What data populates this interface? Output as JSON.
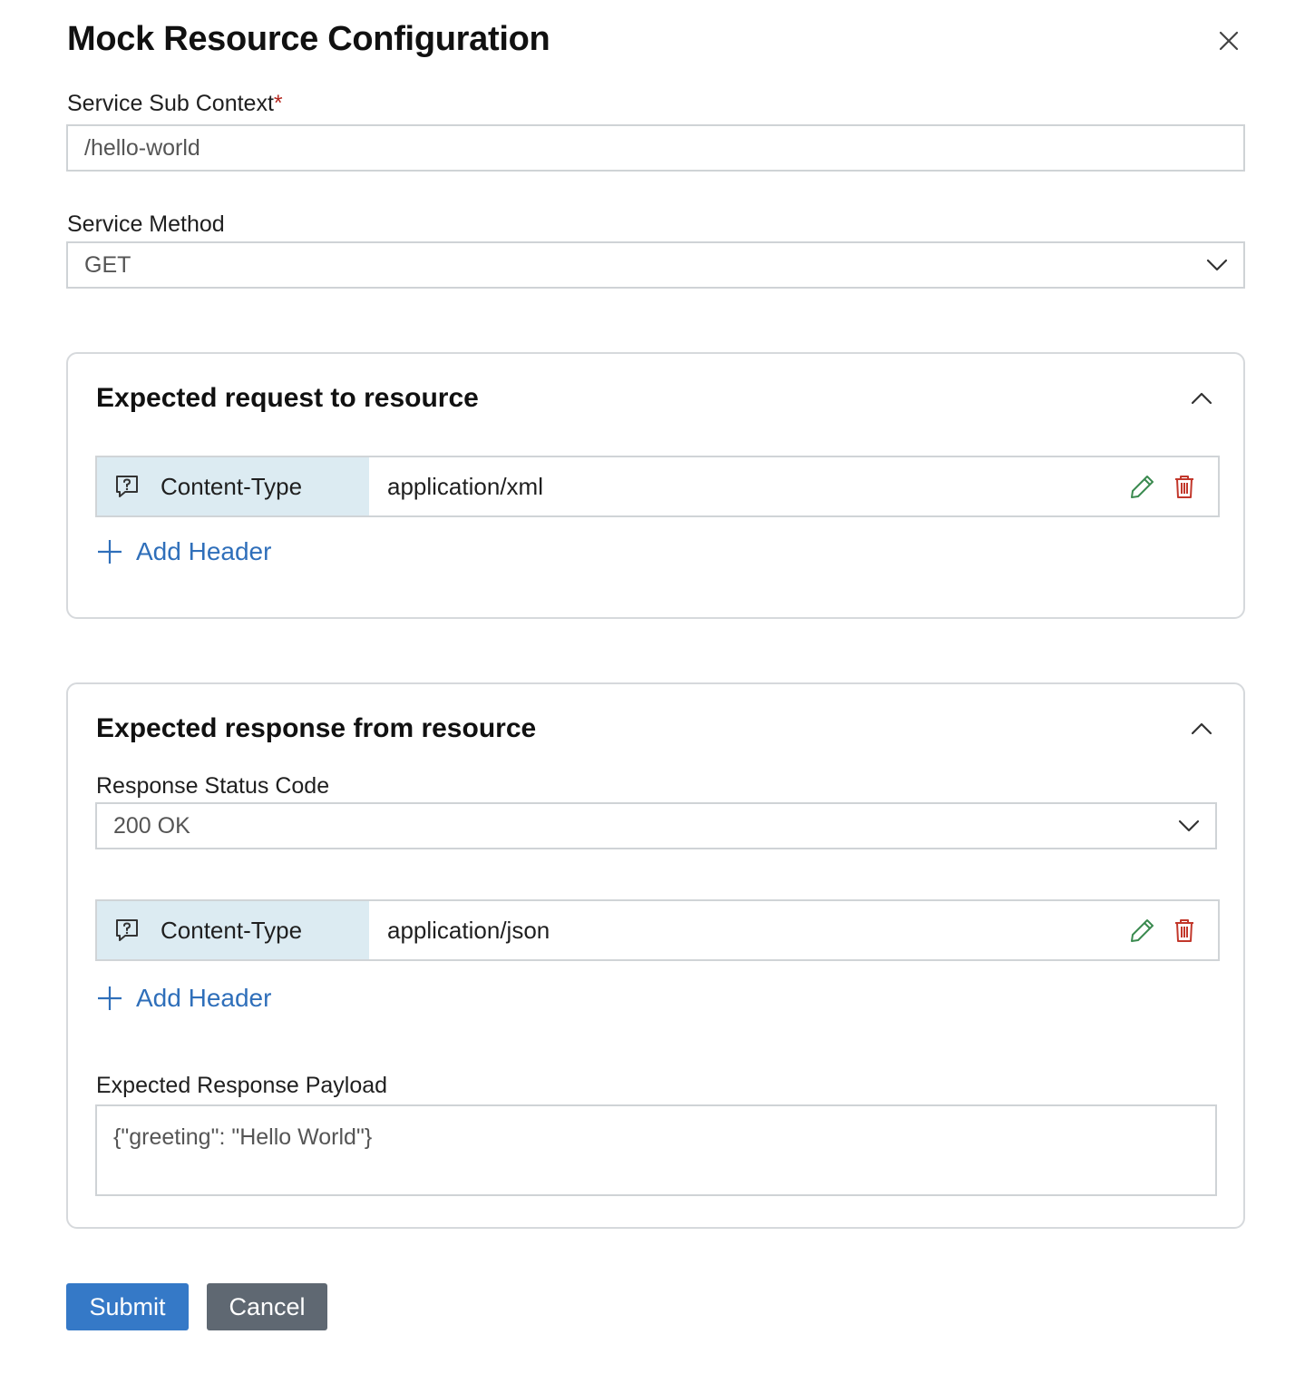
{
  "dialog": {
    "title": "Mock Resource Configuration"
  },
  "sub_context": {
    "label": "Service Sub Context",
    "required_mark": "*",
    "value": "/hello-world"
  },
  "method": {
    "label": "Service Method",
    "selected": "GET"
  },
  "request_panel": {
    "title": "Expected request to resource",
    "headers": [
      {
        "name": "Content-Type",
        "value": "application/xml"
      }
    ],
    "add_header_label": "Add Header"
  },
  "response_panel": {
    "title": "Expected response from resource",
    "status_label": "Response Status Code",
    "status_selected": "200 OK",
    "headers": [
      {
        "name": "Content-Type",
        "value": "application/json"
      }
    ],
    "add_header_label": "Add Header",
    "payload_label": "Expected Response Payload",
    "payload_value": "{\"greeting\": \"Hello World\"}"
  },
  "actions": {
    "submit_label": "Submit",
    "cancel_label": "Cancel"
  },
  "icons": {
    "close": "close-icon",
    "chevron": "chevron-down-icon",
    "collapse": "chevron-up-icon",
    "header": "comment-help-icon",
    "edit": "pencil-icon",
    "delete": "trash-icon",
    "add": "plus-icon"
  },
  "colors": {
    "primary": "#3579c7",
    "secondary": "#5f6872",
    "link": "#2f6fba",
    "edit": "#3a8a4f",
    "delete": "#c2372b",
    "key_bg": "#dcebf2"
  }
}
